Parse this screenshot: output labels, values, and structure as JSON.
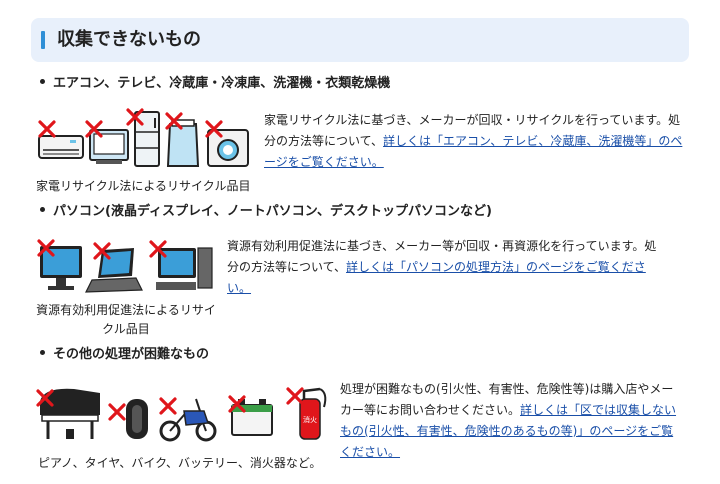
{
  "section": {
    "title": "収集できないもの"
  },
  "groups": [
    {
      "heading": "エアコン、テレビ、冷蔵庫・冷凍庫、洗濯機・衣類乾燥機",
      "desc_text": "家電リサイクル法に基づき、メーカーが回収・リサイクルを行っています。処分の方法等について、",
      "link": "詳しくは「エアコン、テレビ、冷蔵庫、洗濯機等」のページをご覧ください。",
      "caption": "家電リサイクル法によるリサイクル品目",
      "icons": [
        "air-conditioner-icon",
        "television-icon",
        "refrigerator-icon",
        "washing-machine-icon",
        "clothes-dryer-icon"
      ]
    },
    {
      "heading": "パソコン(液晶ディスプレイ、ノートパソコン、デスクトップパソコンなど)",
      "desc_text": "資源有効利用促進法に基づき、メーカー等が回収・再資源化を行っています。処分の方法等について、",
      "link": "詳しくは「パソコンの処理方法」のページをご覧ください。",
      "caption": "資源有効利用促進法によるリサイクル品目",
      "icons": [
        "monitor-icon",
        "laptop-icon",
        "desktop-pc-icon"
      ]
    },
    {
      "heading": "その他の処理が困難なもの",
      "desc_text": "処理が困難なもの(引火性、有害性、危険性等)は購入店やメーカー等にお問い合わせください。",
      "link": "詳しくは「区では収集しないもの(引火性、有害性、危険性のあるもの等)」のページをご覧ください。",
      "caption": "ピアノ、タイヤ、バイク、バッテリー、消火器など。",
      "icons": [
        "piano-icon",
        "tire-icon",
        "motorbike-icon",
        "battery-icon",
        "fire-extinguisher-icon"
      ],
      "extinguisher_label": "消火"
    }
  ],
  "colors": {
    "accent": "#2f8fd6",
    "header_bg": "#e8f0fb",
    "link": "#1a4fa8",
    "cross": "#e0161b"
  }
}
